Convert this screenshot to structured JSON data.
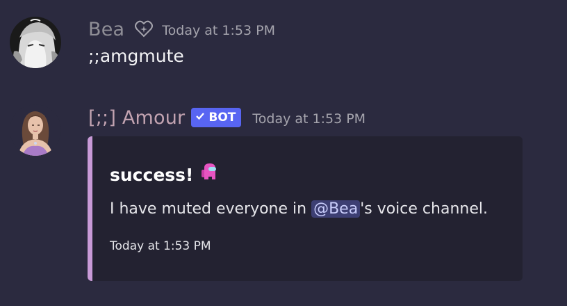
{
  "messages": [
    {
      "username": "Bea",
      "badge_icon": "heart-sparkle-icon",
      "timestamp": "Today at 1:53 PM",
      "content": ";;amgmute",
      "avatar": "anime-character-avatar"
    },
    {
      "username": "[;;] Amour",
      "bot_tag": "BOT",
      "bot_tag_icon": "checkmark-icon",
      "timestamp": "Today at 1:53 PM",
      "avatar": "illustrated-woman-avatar",
      "embed": {
        "title": "success!",
        "title_icon": "crewmate-icon",
        "description_before": "I have muted everyone in ",
        "mention": "@Bea",
        "description_after": "'s voice channel.",
        "footer": "Today at 1:53 PM",
        "accent_color": "#c89ad7"
      }
    }
  ],
  "colors": {
    "background": "#2b2a3f",
    "embed_background": "#232231",
    "bot_tag": "#5865f2",
    "mention_background": "#3d3f73"
  }
}
